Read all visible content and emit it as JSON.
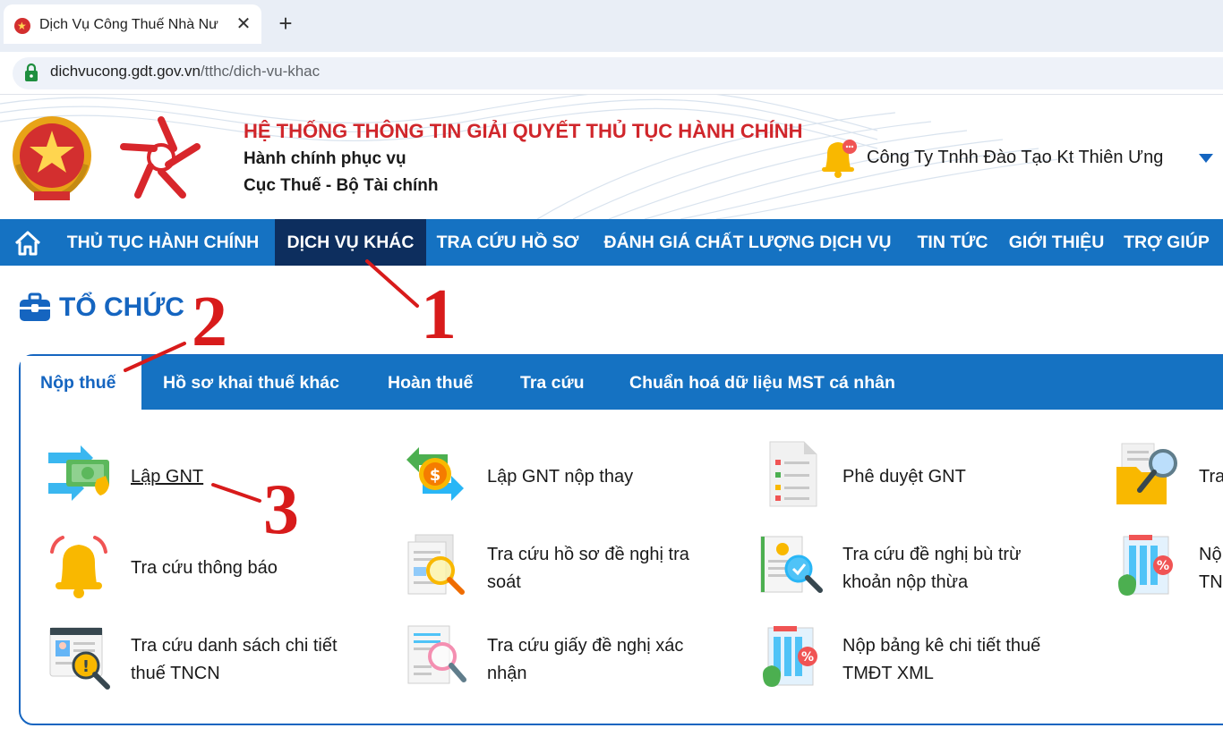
{
  "browser": {
    "tab_title": "Dịch Vụ Công Thuế Nhà Nư",
    "close_symbol": "✕",
    "newtab_symbol": "+",
    "url_host": "dichvucong.gdt.gov.vn",
    "url_path": "/tthc/dich-vu-khac"
  },
  "header": {
    "system_title": "HỆ THỐNG THÔNG TIN GIẢI QUYẾT THỦ TỤC HÀNH CHÍNH",
    "subtitle_1": "Hành chính phục vụ",
    "subtitle_2": "Cục Thuế - Bộ Tài chính",
    "user_name": "Công Ty Tnhh Đào Tạo Kt Thiên Ưng"
  },
  "nav": {
    "items": [
      {
        "label": "THỦ TỤC HÀNH CHÍNH"
      },
      {
        "label": "DỊCH VỤ KHÁC"
      },
      {
        "label": "TRA CỨU HỒ SƠ"
      },
      {
        "label": "ĐÁNH GIÁ CHẤT LƯỢNG DỊCH VỤ"
      },
      {
        "label": "TIN TỨC"
      },
      {
        "label": "GIỚI THIỆU"
      },
      {
        "label": "TRỢ GIÚP"
      }
    ],
    "active_index": 1
  },
  "section": {
    "title": "TỔ CHỨC"
  },
  "subtabs": {
    "items": [
      {
        "label": "Nộp thuế"
      },
      {
        "label": "Hồ sơ khai thuế khác"
      },
      {
        "label": "Hoàn thuế"
      },
      {
        "label": "Tra cứu"
      },
      {
        "label": "Chuẩn hoá dữ liệu MST cá nhân"
      }
    ],
    "active_index": 0
  },
  "services": {
    "lap_gnt": "Lập GNT",
    "lap_gnt_nop_thay": "Lập GNT nộp thay",
    "phe_duyet_gnt": "Phê duyệt GNT",
    "col4_row1": "Tra",
    "tra_cuu_thong_bao": "Tra cứu thông báo",
    "tra_cuu_ho_so_line1": "Tra cứu hồ sơ đề nghị tra",
    "tra_cuu_ho_so_line2": "soát",
    "bu_tru_line1": "Tra cứu đề nghị bù trừ",
    "bu_tru_line2": "khoản nộp thừa",
    "col4_row2_line1": "Nộ",
    "col4_row2_line2": "TN",
    "tncn_line1": "Tra cứu danh sách chi tiết",
    "tncn_line2": "thuế TNCN",
    "xac_nhan_line1": "Tra cứu giấy đề nghị xác",
    "xac_nhan_line2": "nhận",
    "tmdt_line1": "Nộp bảng kê chi tiết thuế",
    "tmdt_line2": "TMĐT XML"
  },
  "annotations": {
    "step1": "1",
    "step2": "2",
    "step3": "3",
    "color": "#d81b1b"
  },
  "colors": {
    "nav_blue": "#1572c2",
    "nav_active": "#0d2e5e",
    "title_red": "#d0262b",
    "heading_blue": "#1565c0"
  }
}
